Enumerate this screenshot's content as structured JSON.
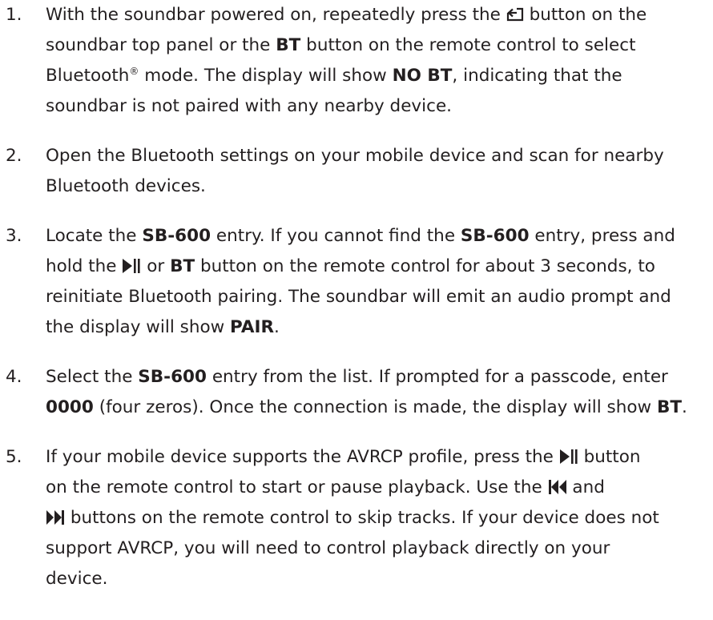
{
  "steps": [
    {
      "number": "1.",
      "lines": [
        [
          "With the soundbar powered on, repeatedly press the",
          "button on the"
        ],
        [
          "soundbar top panel or the",
          "BT",
          "button on the remote control to select"
        ],
        [
          "Bluetooth",
          "®",
          " mode. The display will show",
          "NO BT",
          ", indicating that the"
        ],
        [
          "soundbar is not paired with any nearby device."
        ]
      ]
    },
    {
      "number": "2.",
      "lines": [
        [
          "Open the Bluetooth settings on your mobile device and scan for nearby"
        ],
        [
          "Bluetooth devices."
        ]
      ]
    },
    {
      "number": "3.",
      "lines": [
        [
          "Locate the",
          "SB-600",
          "entry. If you cannot find the",
          "SB-600",
          "entry, press and"
        ],
        [
          "hold the",
          "or",
          "BT",
          "button on the remote control for about 3 seconds, to"
        ],
        [
          "reinitiate Bluetooth pairing. The soundbar will emit an audio prompt and"
        ],
        [
          "the display will show",
          "PAIR",
          "."
        ]
      ]
    },
    {
      "number": "4.",
      "lines": [
        [
          "Select the",
          "SB-600",
          "entry from the list. If prompted for a passcode, enter"
        ],
        [
          "0000",
          "(four zeros). Once the connection is made, the display will show",
          "BT",
          "."
        ]
      ]
    },
    {
      "number": "5.",
      "lines": [
        [
          "If your mobile device supports the AVRCP profile, press the",
          "button"
        ],
        [
          "on the remote control to start or pause playback. Use the",
          "and"
        ],
        [
          "buttons on the remote control to skip tracks. If your device does not"
        ],
        [
          "support AVRCP, you will need to control playback directly on your"
        ],
        [
          "device."
        ]
      ]
    }
  ],
  "icons": {
    "source": "source-input-icon",
    "play_pause": "play-pause-icon",
    "previous": "previous-track-icon",
    "next": "next-track-icon"
  }
}
